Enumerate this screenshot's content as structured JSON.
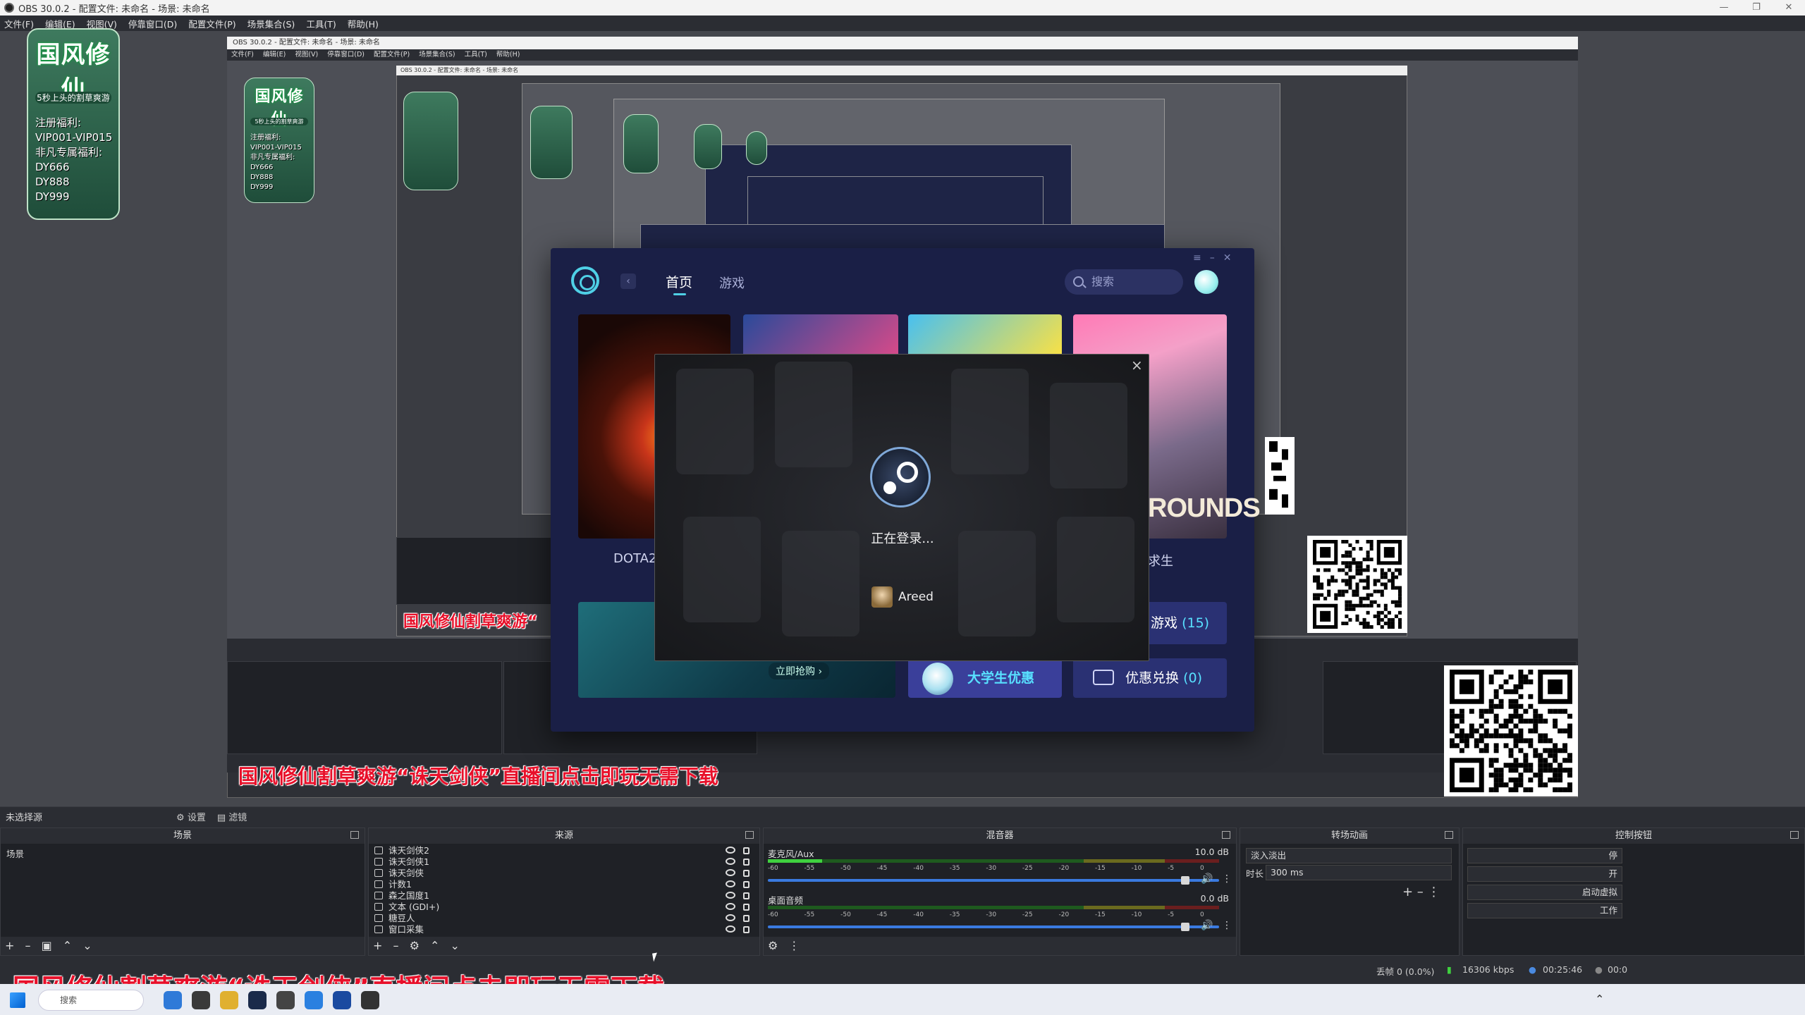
{
  "window": {
    "title": "OBS 30.0.2 - 配置文件: 未命名 - 场景: 未命名",
    "controls": [
      "—",
      "❐",
      "✕"
    ]
  },
  "menu": [
    "文件(F)",
    "编辑(E)",
    "视图(V)",
    "停靠窗口(D)",
    "配置文件(P)",
    "场景集合(S)",
    "工具(T)",
    "帮助(H)"
  ],
  "inner_window": {
    "title": "OBS 30.0.2 - 配置文件: 未命名 - 场景: 未命名",
    "menu": "文件(F) 编辑(E) 视图(V) 停靠窗口(D) 配置文件(P) 场景集合(S) 工具(T) 帮助(H)"
  },
  "poster": {
    "title": "国风修仙",
    "subtitle": "5秒上头的割草爽游",
    "lines": [
      "注册福利:",
      "VIP001-VIP015",
      "非凡专属福利:",
      "DY666",
      "DY888",
      "DY999"
    ]
  },
  "launcher": {
    "tabs": [
      "首页",
      "游戏"
    ],
    "search_placeholder": "搜索",
    "cards": [
      {
        "label": "DOTA2"
      },
      {
        "label": ""
      },
      {
        "label": ""
      },
      {
        "label": "求生"
      }
    ],
    "pubg_text": "ROUNDS",
    "banner_button": "立即抢购 ›",
    "student": "大学生优惠",
    "games_label": "游戏",
    "games_count": "(15)",
    "redeem_label": "优惠兑换",
    "redeem_count": "(0)"
  },
  "steam_dialog": {
    "status": "正在登录...",
    "username": "Areed"
  },
  "subtitles": {
    "inner": "国风修仙割草爽游“诛天剑侠”直播间点击即玩无需下载",
    "outer": "国风修仙割草爽游“诛天剑侠”直播间点击即玩无需下载",
    "mini": "国风修仙割草爽游“"
  },
  "selection_bar": {
    "label": "未选择源",
    "properties": "设置",
    "filters": "滤镜"
  },
  "docks": {
    "scenes": {
      "title": "场景",
      "items": [
        "场景"
      ]
    },
    "sources": {
      "title": "来源",
      "items": [
        "诛天剑侠2",
        "诛天剑侠1",
        "诛天剑侠",
        "计数1",
        "森之国度1",
        "文本 (GDI+)",
        "糖豆人",
        "窗口采集"
      ]
    },
    "mixer": {
      "title": "混音器",
      "tracks": [
        {
          "name": "麦克风/Aux",
          "db": "10.0 dB"
        },
        {
          "name": "桌面音频",
          "db": "0.0 dB"
        }
      ],
      "scale": "-60 -55 -50 -45 -40 -35 -30 -25 -20 -15 -10 -5 0"
    },
    "transitions": {
      "title": "转场动画",
      "type": "淡入淡出",
      "duration_label": "时长",
      "duration": "300 ms"
    },
    "controls": {
      "title": "控制按钮",
      "buttons": [
        "停",
        "开",
        "启动虚拟",
        "工作"
      ]
    }
  },
  "status": {
    "dropped": "丢帧 0 (0.0%)",
    "bitrate": "16306 kbps",
    "time": "00:25:46",
    "time2": "00:0"
  },
  "taskbar": {
    "search": "搜索"
  },
  "colors": {
    "launcher_bg": "#1a1f46",
    "accent": "#4fd0e6",
    "subtitle_red": "#e8102a",
    "obs_dark": "#2b2d33"
  }
}
